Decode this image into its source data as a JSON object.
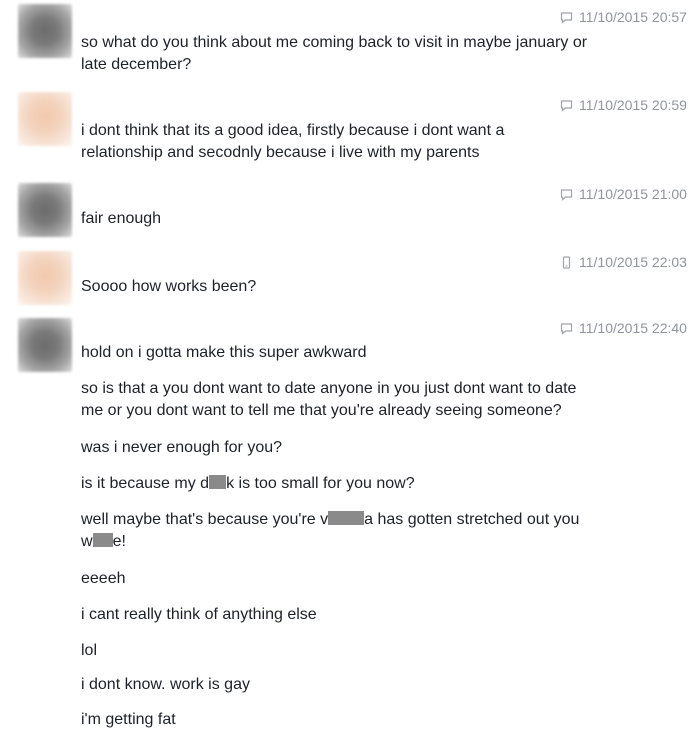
{
  "messages": [
    {
      "sender": "gray",
      "timestamp": "11/10/2015 20:57",
      "meta_icon": "chat-bubble-icon",
      "lines": [
        "so what do you think about me coming back to visit in maybe january or",
        "late december?"
      ]
    },
    {
      "sender": "peach",
      "timestamp": "11/10/2015 20:59",
      "meta_icon": "chat-bubble-icon",
      "lines": [
        "i dont think that its a good idea, firstly because i dont want a",
        "relationship and secodnly because i live with my parents"
      ]
    },
    {
      "sender": "gray",
      "timestamp": "11/10/2015 21:00",
      "meta_icon": "chat-bubble-icon",
      "lines": [
        "fair enough"
      ]
    },
    {
      "sender": "peach",
      "timestamp": "11/10/2015 22:03",
      "meta_icon": "mobile-phone-icon",
      "lines": [
        "Soooo how works been?"
      ]
    },
    {
      "sender": "gray",
      "timestamp": "11/10/2015 22:40",
      "meta_icon": "chat-bubble-icon",
      "lines": [
        "hold on i gotta make this super awkward",
        "so is that a you dont want to date anyone in you just dont want to date",
        "me or you dont want to tell me that you're already seeing someone?",
        "was i never enough for you?",
        "is it because my d k is too small for you now?",
        "well maybe that's because you're v a has gotten stretched out you",
        "w e!",
        "eeeeh",
        "i cant really think of anything else",
        "lol",
        "i dont know. work is gay",
        "i'm getting fat"
      ],
      "censored": {
        "line5": [
          "is it because my d",
          "k is too small for you now?"
        ],
        "line6": [
          "well maybe that's because you're v",
          "a has gotten stretched out you"
        ],
        "line7": [
          "w",
          "e!"
        ]
      }
    }
  ]
}
